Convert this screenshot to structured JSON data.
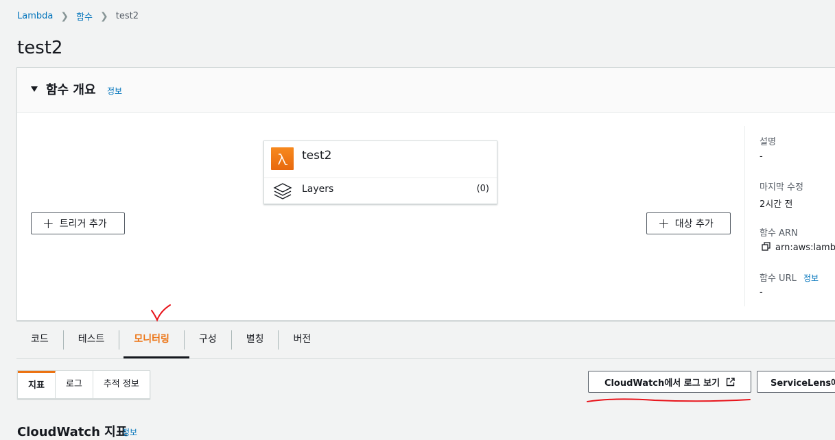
{
  "breadcrumb": {
    "items": [
      "Lambda",
      "함수"
    ],
    "current": "test2"
  },
  "page_title": "test2",
  "overview": {
    "title": "함수 개요",
    "info": "정보",
    "function_name": "test2",
    "layers_label": "Layers",
    "layers_count": "(0)",
    "add_trigger": "트리거 추가",
    "add_destination": "대상 추가",
    "meta": {
      "description_label": "설명",
      "description_value": "-",
      "last_modified_label": "마지막 수정",
      "last_modified_value": "2시간 전",
      "arn_label": "함수 ARN",
      "arn_value": "arn:aws:lambda",
      "url_label": "함수 URL",
      "url_info": "정보",
      "url_value": "-"
    }
  },
  "tabs": [
    "코드",
    "테스트",
    "모니터링",
    "구성",
    "별칭",
    "버전"
  ],
  "active_tab": "모니터링",
  "segments": [
    "지표",
    "로그",
    "추적 정보"
  ],
  "active_segment": "지표",
  "buttons": {
    "cloudwatch_logs": "CloudWatch에서 로그 보기",
    "servicelens": "ServiceLens에"
  },
  "section": {
    "title": "CloudWatch 지표",
    "info": "정보"
  },
  "colors": {
    "link": "#0073bb",
    "accent": "#ec7211",
    "annotation": "#e8141b"
  }
}
